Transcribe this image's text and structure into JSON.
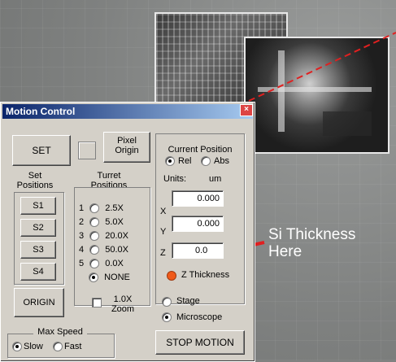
{
  "window": {
    "title": "Motion Control",
    "close_label": "×"
  },
  "buttons": {
    "set": "SET",
    "pixel_origin_line1": "Pixel",
    "pixel_origin_line2": "Origin",
    "s1": "S1",
    "s2": "S2",
    "s3": "S3",
    "s4": "S4",
    "origin": "ORIGIN",
    "stop_motion": "STOP MOTION"
  },
  "labels": {
    "set_positions_line1": "Set",
    "set_positions_line2": "Positions",
    "turret_line1": "Turret",
    "turret_line2": "Positions",
    "current_position_line1": "Current Position",
    "rel": "Rel",
    "abs": "Abs",
    "units": "Units:",
    "units_value": "um",
    "x": "X",
    "y": "Y",
    "z": "Z",
    "z_thickness": "Z Thickness",
    "stage": "Stage",
    "microscope": "Microscope",
    "max_speed": "Max Speed",
    "slow": "Slow",
    "fast": "Fast",
    "zoom_line1": "1.0X",
    "zoom_line2": "Zoom"
  },
  "turret": [
    {
      "num": "1",
      "value": "2.5X"
    },
    {
      "num": "2",
      "value": "5.0X"
    },
    {
      "num": "3",
      "value": "20.0X"
    },
    {
      "num": "4",
      "value": "50.0X"
    },
    {
      "num": "5",
      "value": "0.0X"
    },
    {
      "num": "",
      "value": "NONE"
    }
  ],
  "fields": {
    "x": "0.000",
    "y": "0.000",
    "z": "0.0"
  },
  "callout": {
    "line1": "Si Thickness",
    "line2": "Here"
  },
  "colors": {
    "titlebar": "#0a246a",
    "arrow": "#e02020",
    "led": "#f05a1a"
  }
}
